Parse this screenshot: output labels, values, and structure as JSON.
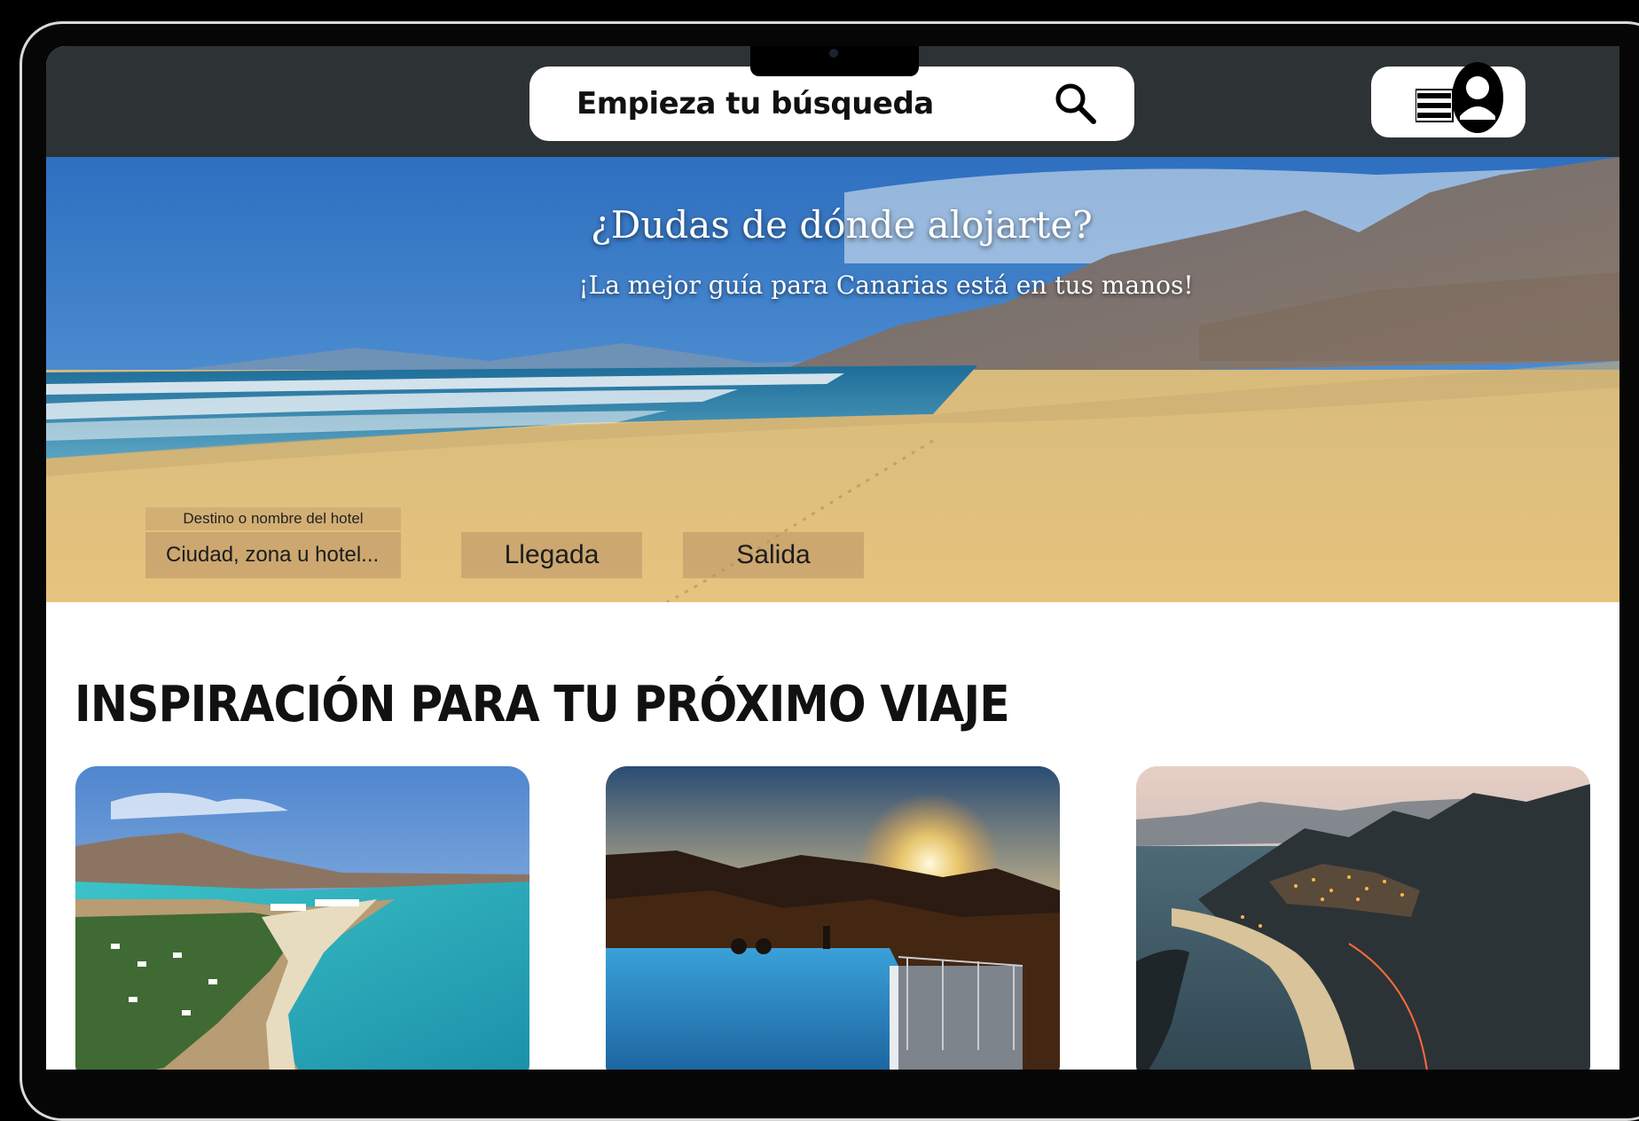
{
  "search": {
    "placeholder_text": "Empieza tu búsqueda"
  },
  "icons": {
    "search": "search-icon",
    "menu": "hamburger-menu-icon",
    "user": "user-avatar-icon"
  },
  "hero": {
    "title": "¿Dudas de dónde alojarte?",
    "subtitle": "¡La mejor guía para Canarias está en tus manos!",
    "destination_label": "Destino o nombre del hotel",
    "destination_placeholder": "Ciudad, zona u hotel...",
    "arrival_label": "Llegada",
    "departure_label": "Salida"
  },
  "inspiration": {
    "title": "INSPIRACIÓN PARA TU PRÓXIMO VIAJE",
    "cards": [
      {
        "name": "coast-photo"
      },
      {
        "name": "sunset-pool-photo"
      },
      {
        "name": "night-town-photo"
      }
    ]
  },
  "colors": {
    "topbar": "#2d3234",
    "field_bg": "#b9916480",
    "page_bg": "#ffffff"
  }
}
